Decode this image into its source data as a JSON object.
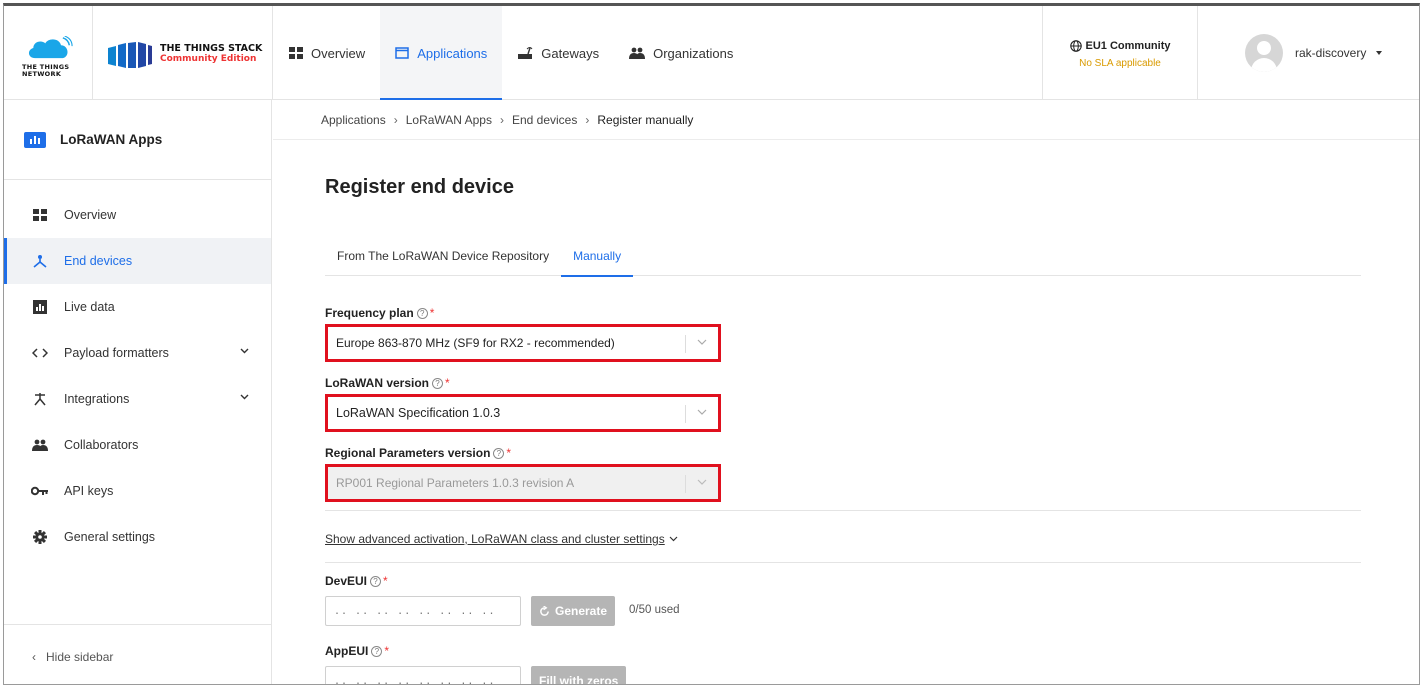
{
  "header": {
    "ttn_logo_text": [
      "THE THINGS",
      "NETWORK"
    ],
    "product_title": "THE THINGS STACK",
    "product_edition": "Community Edition",
    "nav": [
      {
        "label": "Overview",
        "icon": "grid-icon",
        "active": false
      },
      {
        "label": "Applications",
        "icon": "window-icon",
        "active": true
      },
      {
        "label": "Gateways",
        "icon": "gateway-icon",
        "active": false
      },
      {
        "label": "Organizations",
        "icon": "people-icon",
        "active": false
      }
    ],
    "cluster": {
      "name": "EU1 Community",
      "sla": "No SLA applicable"
    },
    "user": {
      "name": "rak-discovery"
    }
  },
  "sidebar": {
    "app_title": "LoRaWAN Apps",
    "items": [
      {
        "label": "Overview",
        "icon": "grid-icon",
        "active": false,
        "expandable": false
      },
      {
        "label": "End devices",
        "icon": "devices-icon",
        "active": true,
        "expandable": false
      },
      {
        "label": "Live data",
        "icon": "bar-chart-icon",
        "active": false,
        "expandable": false
      },
      {
        "label": "Payload formatters",
        "icon": "code-icon",
        "active": false,
        "expandable": true
      },
      {
        "label": "Integrations",
        "icon": "integrations-icon",
        "active": false,
        "expandable": true
      },
      {
        "label": "Collaborators",
        "icon": "people-icon",
        "active": false,
        "expandable": false
      },
      {
        "label": "API keys",
        "icon": "key-icon",
        "active": false,
        "expandable": false
      },
      {
        "label": "General settings",
        "icon": "gear-icon",
        "active": false,
        "expandable": false
      }
    ],
    "hide_label": "Hide sidebar"
  },
  "breadcrumb": [
    "Applications",
    "LoRaWAN Apps",
    "End devices",
    "Register manually"
  ],
  "page": {
    "title": "Register end device",
    "tabs": [
      {
        "label": "From The LoRaWAN Device Repository",
        "active": false
      },
      {
        "label": "Manually",
        "active": true
      }
    ],
    "frequency_plan": {
      "label": "Frequency plan",
      "value": "Europe 863-870 MHz (SF9 for RX2 - recommended)"
    },
    "lorawan_version": {
      "label": "LoRaWAN version",
      "value": "LoRaWAN Specification 1.0.3"
    },
    "regional_params": {
      "label": "Regional Parameters version",
      "value": "RP001 Regional Parameters 1.0.3 revision A"
    },
    "advanced_link": "Show advanced activation, LoRaWAN class and cluster settings",
    "dev_eui": {
      "label": "DevEUI",
      "placeholder": ".. .. .. .. .. .. .. ..",
      "generate_label": "Generate",
      "usage": "0/50 used"
    },
    "app_eui": {
      "label": "AppEUI",
      "placeholder": ".. .. .. .. .. .. .. ..",
      "fill_label": "Fill with zeros"
    }
  },
  "colors": {
    "accent": "#1e6ee8",
    "highlight": "#e0101e",
    "required": "#ee3333",
    "sla": "#d99a00"
  }
}
